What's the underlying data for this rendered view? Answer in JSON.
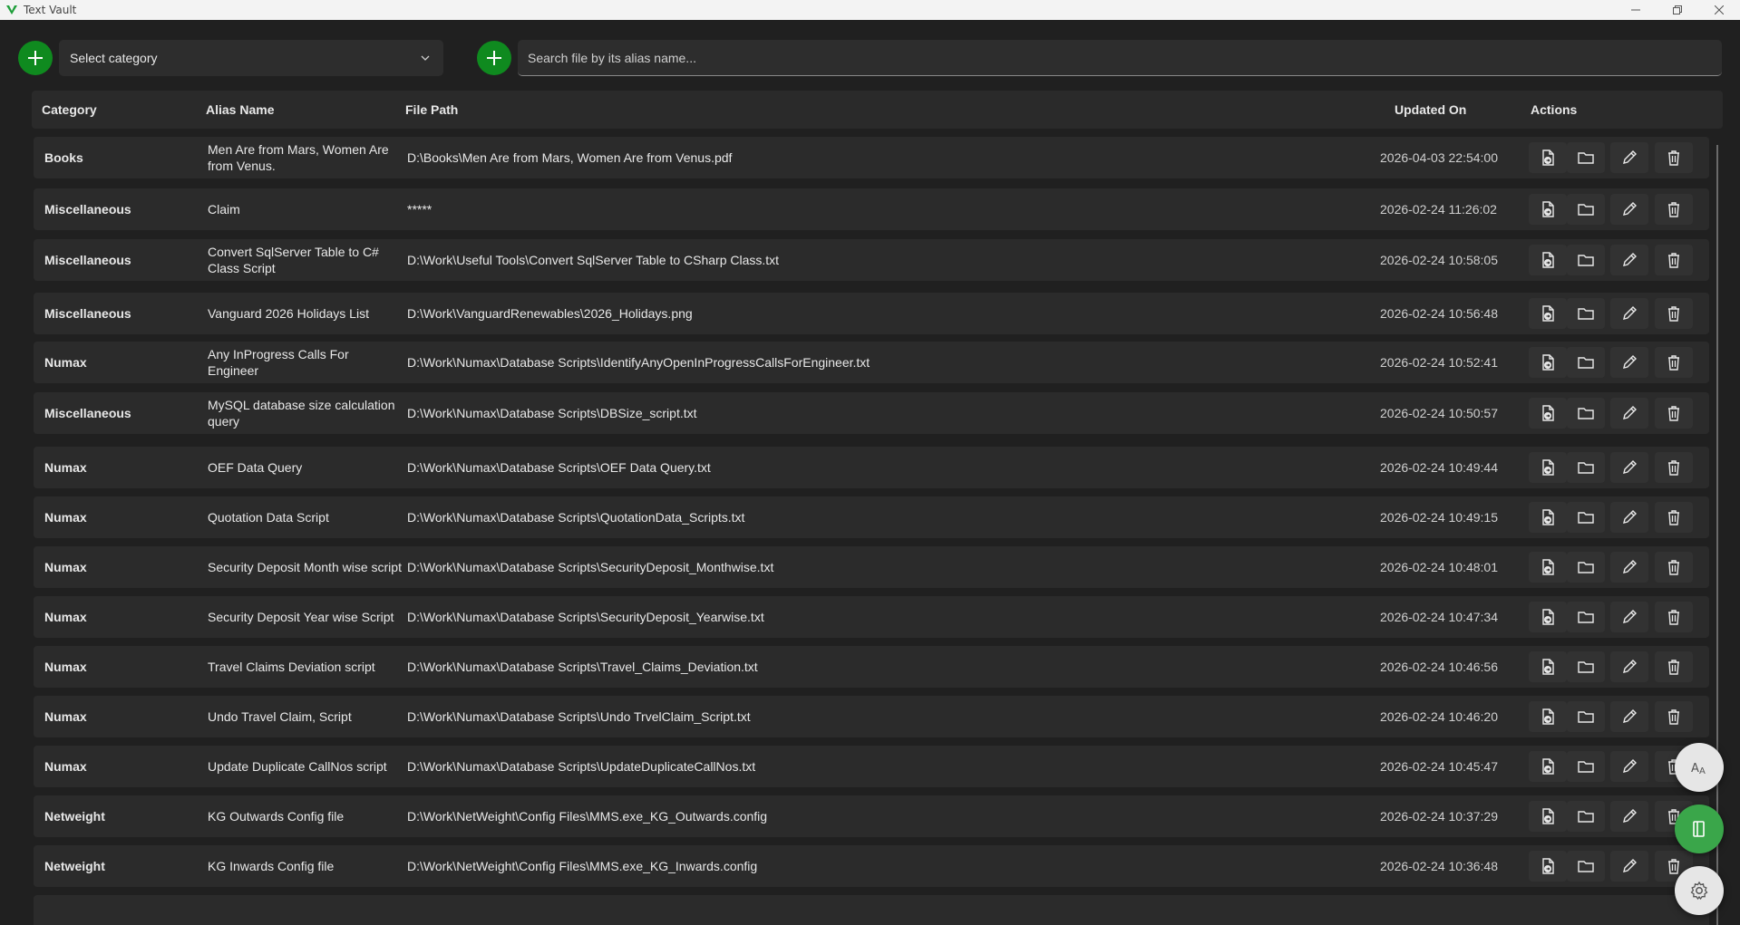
{
  "window": {
    "title": "Text Vault"
  },
  "toolbar": {
    "category_placeholder": "Select category",
    "search_placeholder": "Search file by its alias name..."
  },
  "table": {
    "headers": {
      "category": "Category",
      "alias": "Alias Name",
      "path": "File Path",
      "updated": "Updated On",
      "actions": "Actions"
    },
    "rows": [
      {
        "category": "Books",
        "alias": "Men Are from Mars, Women Are from Venus.",
        "path": "D:\\Books\\Men Are from Mars, Women Are from Venus.pdf",
        "updated": "2026-04-03 22:54:00"
      },
      {
        "category": "Miscellaneous",
        "alias": "Claim",
        "path": "*****",
        "updated": "2026-02-24 11:26:02"
      },
      {
        "category": "Miscellaneous",
        "alias": "Convert SqlServer Table to C# Class Script",
        "path": "D:\\Work\\Useful Tools\\Convert SqlServer Table to CSharp Class.txt",
        "updated": "2026-02-24 10:58:05"
      },
      {
        "category": "Miscellaneous",
        "alias": "Vanguard 2026 Holidays List",
        "path": "D:\\Work\\VanguardRenewables\\2026_Holidays.png",
        "updated": "2026-02-24 10:56:48"
      },
      {
        "category": "Numax",
        "alias": "Any InProgress Calls For Engineer",
        "path": "D:\\Work\\Numax\\Database Scripts\\IdentifyAnyOpenInProgressCallsForEngineer.txt",
        "updated": "2026-02-24 10:52:41"
      },
      {
        "category": "Miscellaneous",
        "alias": "MySQL database size calculation query",
        "path": "D:\\Work\\Numax\\Database Scripts\\DBSize_script.txt",
        "updated": "2026-02-24 10:50:57"
      },
      {
        "category": "Numax",
        "alias": "OEF Data Query",
        "path": "D:\\Work\\Numax\\Database Scripts\\OEF Data Query.txt",
        "updated": "2026-02-24 10:49:44"
      },
      {
        "category": "Numax",
        "alias": "Quotation Data Script",
        "path": "D:\\Work\\Numax\\Database Scripts\\QuotationData_Scripts.txt",
        "updated": "2026-02-24 10:49:15"
      },
      {
        "category": "Numax",
        "alias": "Security Deposit Month wise script",
        "path": "D:\\Work\\Numax\\Database Scripts\\SecurityDeposit_Monthwise.txt",
        "updated": "2026-02-24 10:48:01"
      },
      {
        "category": "Numax",
        "alias": "Security Deposit Year wise Script",
        "path": "D:\\Work\\Numax\\Database Scripts\\SecurityDeposit_Yearwise.txt",
        "updated": "2026-02-24 10:47:34"
      },
      {
        "category": "Numax",
        "alias": "Travel Claims Deviation script",
        "path": "D:\\Work\\Numax\\Database Scripts\\Travel_Claims_Deviation.txt",
        "updated": "2026-02-24 10:46:56"
      },
      {
        "category": "Numax",
        "alias": "Undo Travel Claim, Script",
        "path": "D:\\Work\\Numax\\Database Scripts\\Undo TrvelClaim_Script.txt",
        "updated": "2026-02-24 10:46:20"
      },
      {
        "category": "Numax",
        "alias": "Update Duplicate CallNos script",
        "path": "D:\\Work\\Numax\\Database Scripts\\UpdateDuplicateCallNos.txt",
        "updated": "2026-02-24 10:45:47"
      },
      {
        "category": "Netweight",
        "alias": "KG Outwards Config file",
        "path": "D:\\Work\\NetWeight\\Config Files\\MMS.exe_KG_Outwards.config",
        "updated": "2026-02-24 10:37:29"
      },
      {
        "category": "Netweight",
        "alias": "KG Inwards Config file",
        "path": "D:\\Work\\NetWeight\\Config Files\\MMS.exe_KG_Inwards.config",
        "updated": "2026-02-24 10:36:48"
      }
    ]
  },
  "icons": {
    "row_actions": [
      "open-file-icon",
      "open-folder-icon",
      "edit-icon",
      "delete-icon"
    ],
    "fabs": [
      "font-size-icon",
      "export-icon",
      "settings-icon"
    ]
  },
  "colors": {
    "accent_green": "#0f8a1f",
    "fab_green": "#3aa64a",
    "background": "#202020",
    "row": "#2b2b2b"
  }
}
